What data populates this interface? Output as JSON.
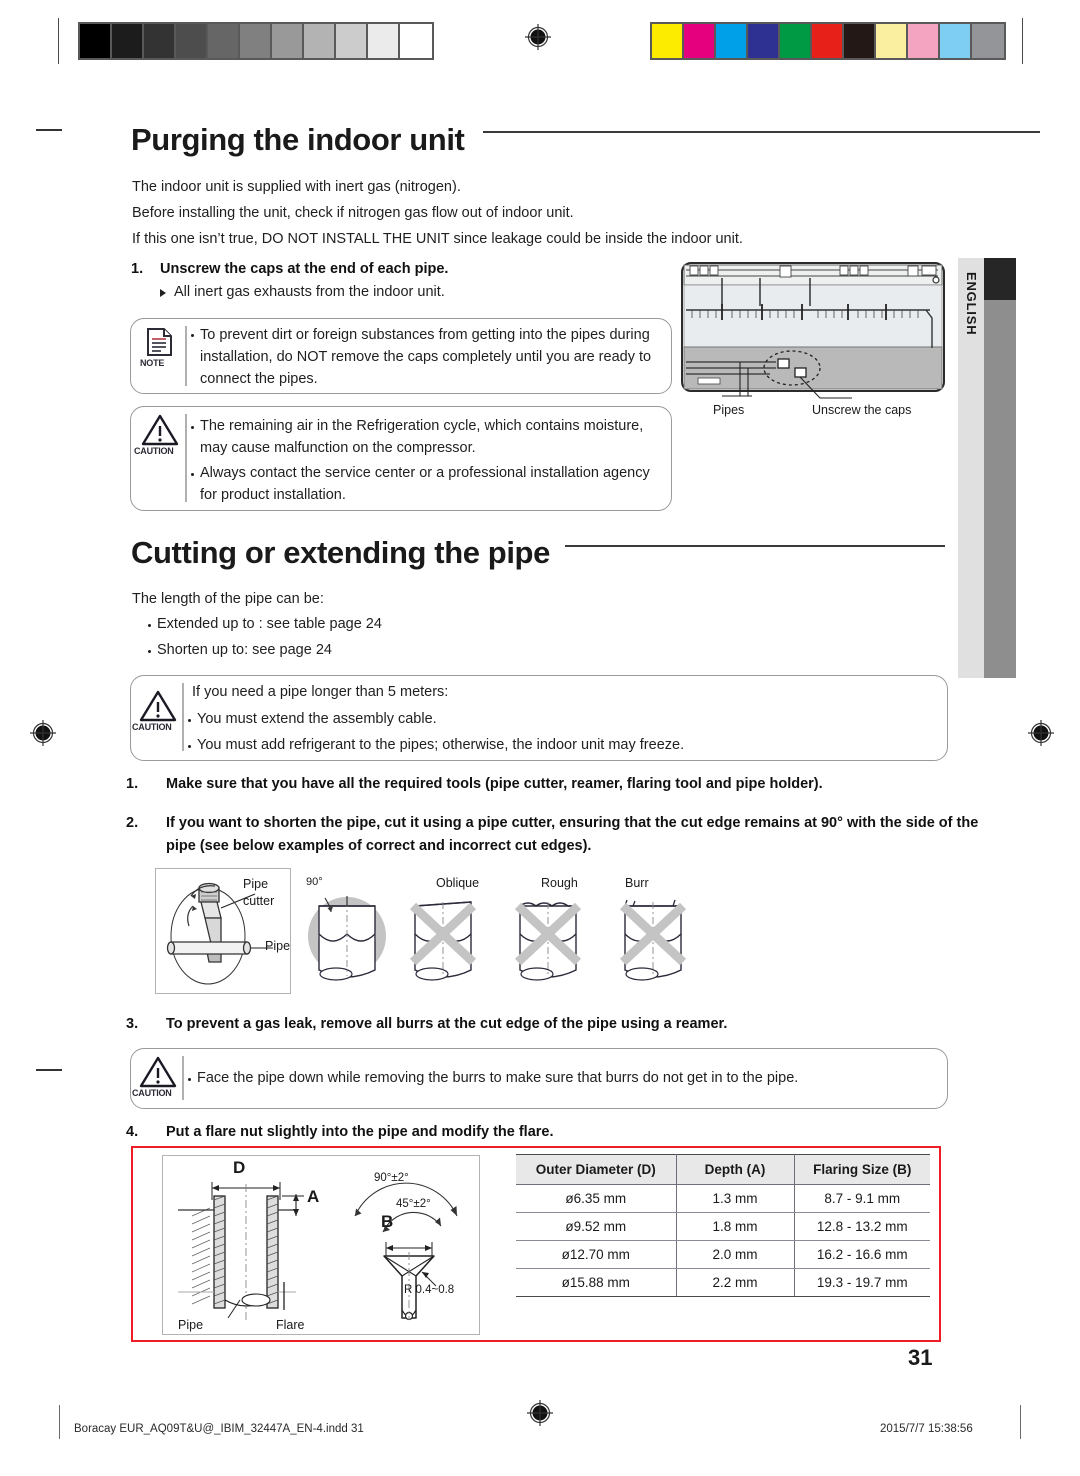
{
  "document": {
    "page_number": "31",
    "language_tab": "ENGLISH",
    "footer_file": "Boracay EUR_AQ09T&U@_IBIM_32447A_EN-4.indd   31",
    "footer_timestamp": "2015/7/7   15:38:56"
  },
  "calibration": {
    "grayscale": [
      "#000000",
      "#1c1c1c",
      "#333333",
      "#4d4d4d",
      "#666666",
      "#808080",
      "#999999",
      "#b3b3b3",
      "#cccccc",
      "#ebebeb",
      "#ffffff"
    ],
    "colors": [
      "#fced00",
      "#e5007d",
      "#00a0e9",
      "#2e3192",
      "#009944",
      "#e7211a",
      "#231815",
      "#faeea0",
      "#f4a3c0",
      "#7ecef4",
      "#939598"
    ]
  },
  "section1": {
    "heading": "Purging the indoor unit",
    "intro": [
      "The indoor unit is supplied with inert gas  (nitrogen).",
      "Before installing the unit, check if nitrogen gas flow out of indoor unit.",
      "If this one isn’t true, DO NOT INSTALL THE UNIT since leakage could be inside the indoor unit."
    ],
    "step1_num": "1.",
    "step1_text": "Unscrew the caps at the end of each pipe.",
    "step1_sub": "All inert gas exhausts from the indoor unit.",
    "note_box": {
      "icon_label": "NOTE",
      "lines": [
        "To prevent dirt or foreign substances from getting into the pipes during",
        "installation, do NOT remove the caps completely until you are ready to",
        "connect the pipes."
      ]
    },
    "caution_box": {
      "icon_label": "CAUTION",
      "bullet1": [
        "The remaining air in the Refrigeration cycle, which contains moisture,",
        "may cause malfunction on the compressor."
      ],
      "bullet2": [
        "Always contact the service center or a professional installation agency",
        "for product installation."
      ]
    },
    "illustration": {
      "label_pipes": "Pipes",
      "label_caps": "Unscrew the caps"
    }
  },
  "section2": {
    "heading": "Cutting or extending the pipe",
    "intro": "The length of the pipe can be:",
    "bullets": [
      "Extended up to : see table page 24",
      "Shorten up to: see page 24"
    ],
    "caution_box": {
      "icon_label": "CAUTION",
      "intro": "If you need a pipe longer than 5 meters:",
      "bullets": [
        "You must extend the assembly cable.",
        "You must add refrigerant to the pipes; otherwise, the indoor unit may freeze."
      ]
    },
    "steps": [
      {
        "num": "1.",
        "lines": [
          "Make sure that you have all the required tools (pipe cutter, reamer, flaring tool and pipe holder)."
        ]
      },
      {
        "num": "2.",
        "lines": [
          "If you want to shorten the pipe, cut it using a pipe cutter, ensuring that the cut edge remains at 90° with the side of the",
          "pipe (see below examples of correct and incorrect cut edges)."
        ]
      },
      {
        "num": "3.",
        "lines": [
          "To prevent a gas leak, remove all burrs at the cut edge of the pipe using a reamer."
        ]
      },
      {
        "num": "4.",
        "lines": [
          "Put a flare nut slightly into the pipe and modify the flare."
        ]
      }
    ],
    "cut_diagram": {
      "tool_label_line1": "Pipe",
      "tool_label_line2": "cutter",
      "tool_label_pipe": "Pipe",
      "angle": "90°",
      "bad_labels": [
        "Oblique",
        "Rough",
        "Burr"
      ]
    },
    "caution_box3": {
      "icon_label": "CAUTION",
      "bullet": "Face the pipe down while removing the burrs to make sure that burrs do not get in to the pipe."
    },
    "flare_diagram": {
      "label_d": "D",
      "label_a": "A",
      "label_b": "B",
      "label_pipe": "Pipe",
      "label_flare": "Flare",
      "angle_outer": "90°±2°",
      "angle_inner": "45°±2°",
      "radius": "R 0.4~0.8"
    }
  },
  "flare_table": {
    "headers": [
      "Outer Diameter (D)",
      "Depth (A)",
      "Flaring Size (B)"
    ],
    "rows": [
      [
        "ø6.35 mm",
        "1.3 mm",
        "8.7 - 9.1 mm"
      ],
      [
        "ø9.52 mm",
        "1.8 mm",
        "12.8 - 13.2 mm"
      ],
      [
        "ø12.70 mm",
        "2.0 mm",
        "16.2 - 16.6 mm"
      ],
      [
        "ø15.88 mm",
        "2.2 mm",
        "19.3 - 19.7 mm"
      ]
    ]
  }
}
